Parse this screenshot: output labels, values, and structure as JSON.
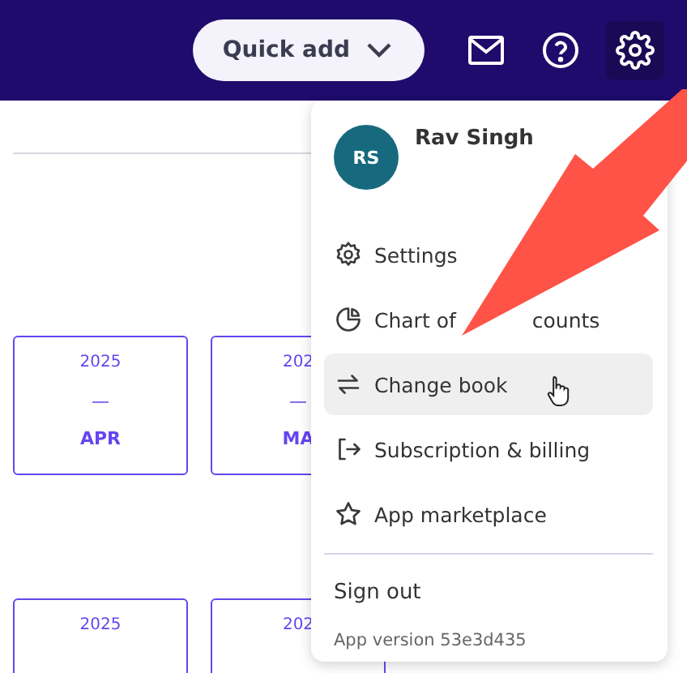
{
  "header": {
    "quick_add": {
      "label": "Quick add"
    }
  },
  "cards": [
    {
      "year": "2025",
      "dash": "—",
      "month": "APR"
    },
    {
      "year": "202",
      "dash": "—",
      "month": "MA"
    },
    {
      "year": "2025"
    },
    {
      "year": "202"
    }
  ],
  "account_menu": {
    "user": {
      "initials": "RS",
      "name": "Rav Singh"
    },
    "items": [
      {
        "kind": "settings",
        "label": "Settings",
        "hovered": false
      },
      {
        "kind": "chart",
        "label_parts": [
          "Chart of",
          "counts"
        ],
        "hovered": false
      },
      {
        "kind": "swap",
        "label": "Change book",
        "hovered": true
      },
      {
        "kind": "exit",
        "label": "Subscription & billing",
        "hovered": false
      },
      {
        "kind": "star",
        "label": "App marketplace",
        "hovered": false
      }
    ],
    "sign_out": "Sign out",
    "version": "App version 53e3d435"
  }
}
